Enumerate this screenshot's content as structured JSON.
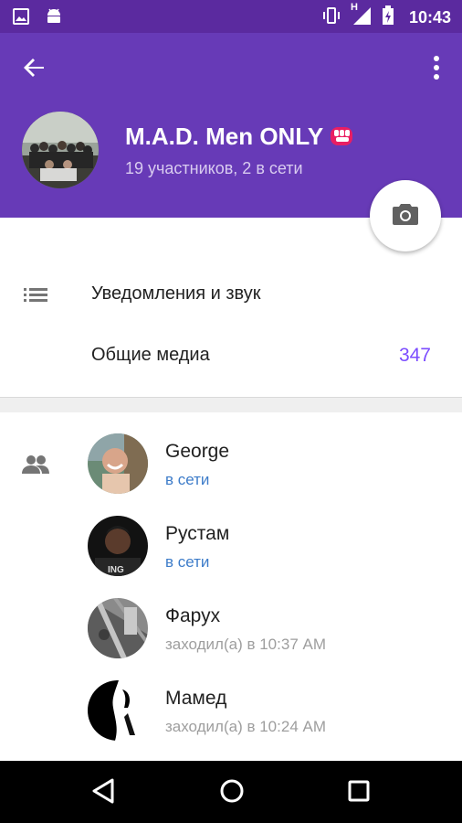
{
  "status_bar": {
    "time": "10:43",
    "network": "H",
    "left_icons": [
      "image-icon",
      "android-icon"
    ],
    "right_icons": [
      "vibrate-icon",
      "signal-icon",
      "battery-charging-icon"
    ]
  },
  "header": {
    "back_icon": "arrow-left-icon",
    "menu_icon": "more-vertical-icon",
    "title": "M.A.D. Men ONLY",
    "title_emoji": "fist-emoji",
    "subtitle": "19 участников, 2 в сети",
    "background_color": "#673ab7",
    "camera_icon": "camera-icon"
  },
  "settings": {
    "notifications_label": "Уведомления и звук",
    "shared_media_label": "Общие медиа",
    "shared_media_count": "347",
    "accent_color": "#7c4dff"
  },
  "members": [
    {
      "name": "George",
      "status": "в сети",
      "online": true
    },
    {
      "name": "Рустам",
      "status": "в сети",
      "online": true
    },
    {
      "name": "Фарух",
      "status": "заходил(а) в 10:37 AM",
      "online": false
    },
    {
      "name": "Мамед",
      "status": "заходил(а) в 10:24 AM",
      "online": false
    }
  ],
  "nav_bar": {
    "buttons": [
      "back-triangle-icon",
      "home-circle-icon",
      "recents-square-icon"
    ]
  }
}
